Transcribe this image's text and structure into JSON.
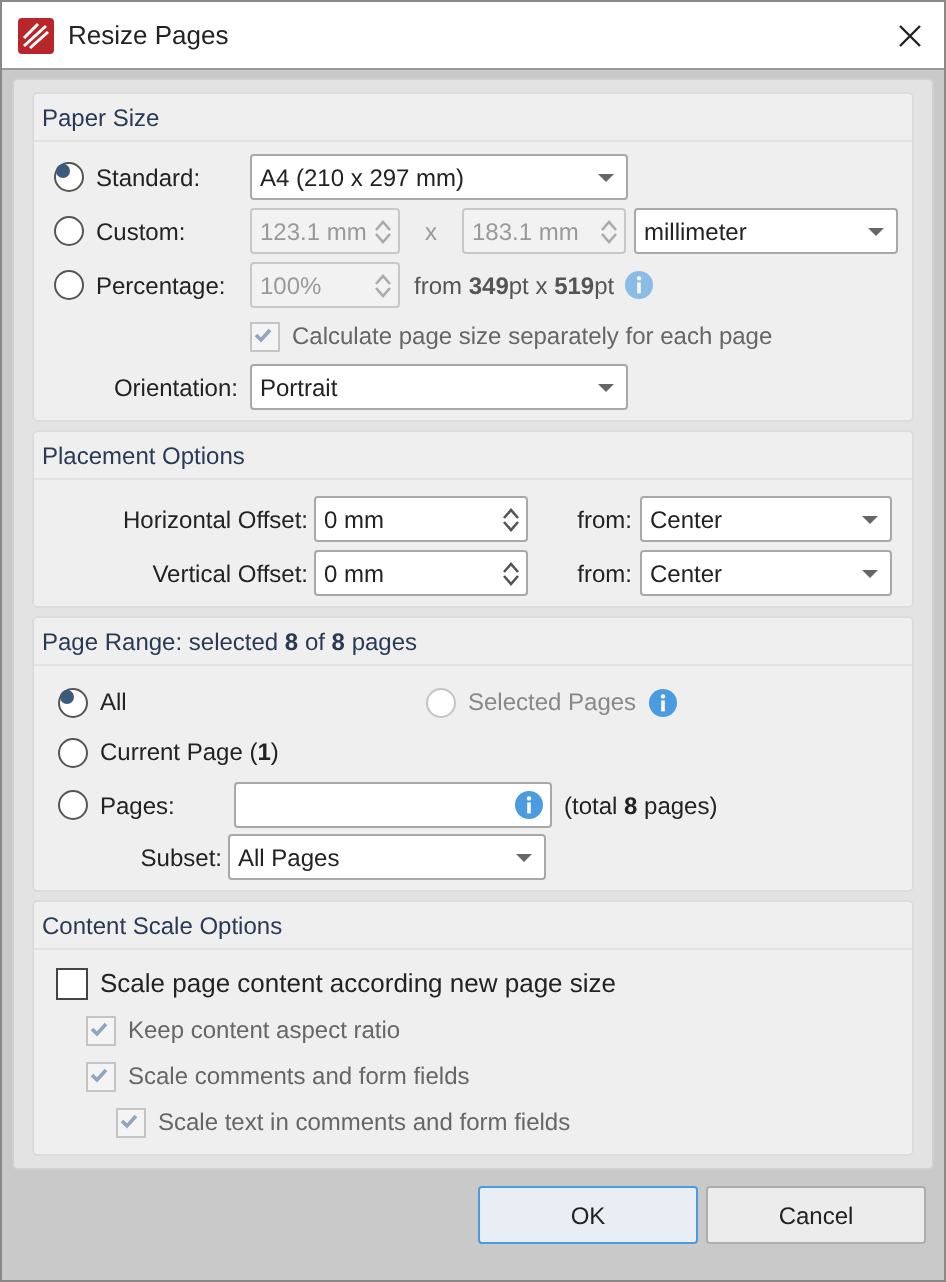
{
  "window": {
    "title": "Resize Pages"
  },
  "paper_size": {
    "title": "Paper Size",
    "options": [
      {
        "label": "Standard:",
        "selected": true
      },
      {
        "label": "Custom:",
        "selected": false
      },
      {
        "label": "Percentage:",
        "selected": false
      }
    ],
    "standard": {
      "value": "A4 (210 x 297 mm)"
    },
    "custom": {
      "width": "123.1 mm",
      "separator": "x",
      "height": "183.1 mm",
      "unit": "millimeter",
      "disabled": true
    },
    "percentage": {
      "value": "100%",
      "from_text": "from **349**pt x **519**pt",
      "disabled": true
    },
    "calculate_separately": {
      "label": "Calculate page size separately for each page",
      "checked": true,
      "disabled": true
    },
    "orientation": {
      "label": "Orientation:",
      "value": "Portrait"
    }
  },
  "placement": {
    "title": "Placement Options",
    "rows": [
      {
        "label": "Horizontal Offset:",
        "value": "0 mm",
        "from_label": "from:",
        "from_value": "Center"
      },
      {
        "label": "Vertical Offset:",
        "value": "0 mm",
        "from_label": "from:",
        "from_value": "Center"
      }
    ]
  },
  "page_range": {
    "title": "Page Range: selected **8** of **8** pages",
    "options": [
      {
        "label": "All",
        "selected": true,
        "disabled": false
      },
      {
        "label": "Selected Pages",
        "selected": false,
        "disabled": true
      },
      {
        "label": "Current Page (**1**)",
        "selected": false,
        "disabled": false
      },
      {
        "label": "Pages:",
        "selected": false,
        "disabled": false
      }
    ],
    "pages_total": "(total **8** pages)",
    "subset": {
      "label": "Subset:",
      "value": "All Pages"
    }
  },
  "content_scale": {
    "title": "Content Scale Options",
    "items": [
      {
        "label": "Scale page content according new page size",
        "checked": false,
        "disabled": false
      },
      {
        "label": "Keep content aspect ratio",
        "checked": true,
        "disabled": true
      },
      {
        "label": "Scale comments and form fields",
        "checked": true,
        "disabled": true,
        "children": [
          {
            "label": "Scale text in comments and form fields",
            "checked": true,
            "disabled": true
          }
        ]
      }
    ]
  },
  "buttons": [
    {
      "label": "OK",
      "default": true
    },
    {
      "label": "Cancel",
      "default": false
    }
  ]
}
